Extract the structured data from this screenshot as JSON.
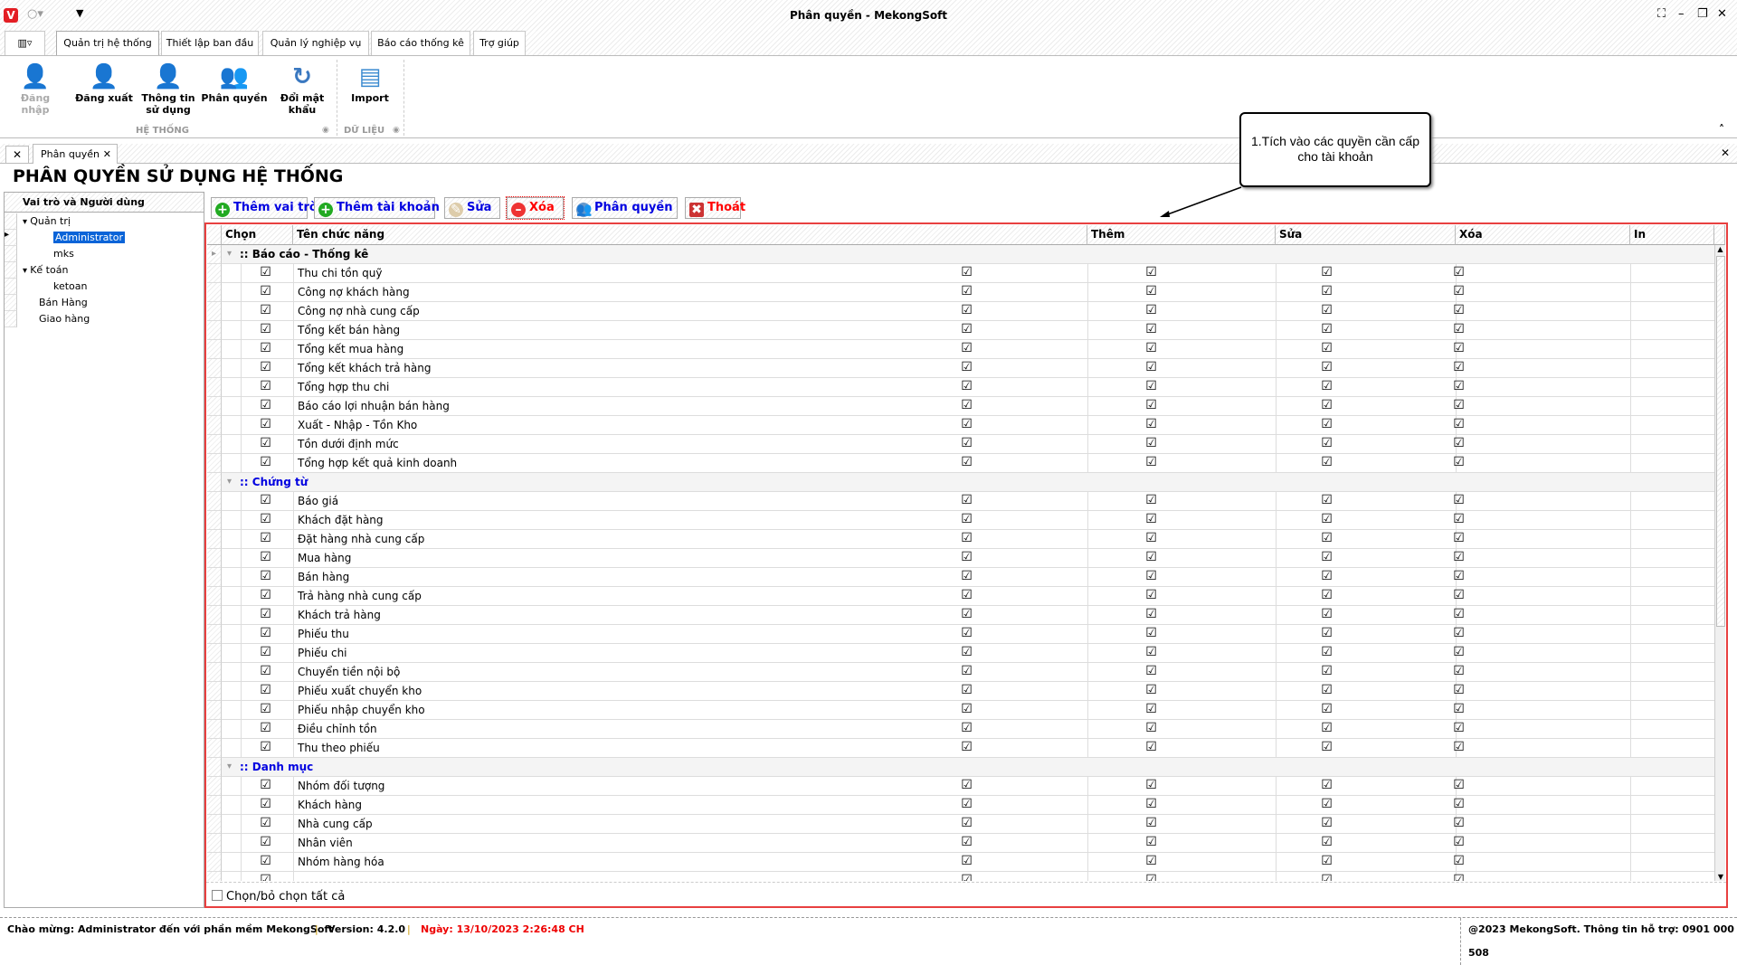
{
  "window": {
    "title": "Phân quyền - MekongSoft",
    "logo": "V"
  },
  "ribbon_tabs": [
    "Quản trị hệ thống",
    "Thiết lập ban đầu",
    "Quản lý nghiệp vụ",
    "Báo cáo thống kê",
    "Trợ giúp"
  ],
  "ribbon": {
    "buttons": [
      {
        "label": "Đăng nhập",
        "icon": "login-user-icon",
        "disabled": true
      },
      {
        "label": "Đăng xuất",
        "icon": "logout-user-icon"
      },
      {
        "label": "Thông tin sử dụng",
        "icon": "user-info-icon"
      },
      {
        "label": "Phân quyền",
        "icon": "users-gear-icon"
      },
      {
        "label": "Đổi mật khẩu",
        "icon": "refresh-icon"
      },
      {
        "label": "Import",
        "icon": "database-icon"
      }
    ],
    "groups": [
      "HỆ THỐNG",
      "DỮ LIỆU"
    ]
  },
  "doc_tab": "Phân quyền",
  "page_title": "PHÂN QUYỀN SỬ DỤNG HỆ THỐNG",
  "left_panel": {
    "header": "Vai trò và Người dùng",
    "nodes": [
      {
        "label": "Quản trị",
        "level": 0,
        "expanded": true
      },
      {
        "label": "Administrator",
        "level": 1,
        "selected": true
      },
      {
        "label": "mks",
        "level": 1
      },
      {
        "label": "Kế toán",
        "level": 0,
        "expanded": true
      },
      {
        "label": "ketoan",
        "level": 1
      },
      {
        "label": "Bán Hàng",
        "level": 0
      },
      {
        "label": "Giao hàng",
        "level": 0
      }
    ]
  },
  "toolbar": [
    {
      "label": "Thêm vai trò",
      "icon": "plus-circle-icon",
      "color": "#0000e0"
    },
    {
      "label": "Thêm tài khoản",
      "icon": "plus-circle-icon",
      "color": "#0000e0"
    },
    {
      "label": "Sửa",
      "icon": "pencil-icon",
      "color": "#0000e0"
    },
    {
      "label": "Xóa",
      "icon": "minus-circle-icon",
      "color": "#ff0000"
    },
    {
      "label": "Phân quyền",
      "icon": "users-icon",
      "color": "#0000e0"
    },
    {
      "label": "Thoát",
      "icon": "close-box-icon",
      "color": "#ff0000"
    }
  ],
  "grid": {
    "columns": [
      "Chọn",
      "Tên chức năng",
      "Thêm",
      "Sửa",
      "Xóa",
      "In"
    ],
    "groups": [
      {
        "title": ":: Báo cáo - Thống kê",
        "color": "#000000",
        "items": [
          "Thu chi tồn quỹ",
          "Công nợ khách hàng",
          "Công nợ nhà cung cấp",
          "Tổng kết bán hàng",
          "Tổng kết mua hàng",
          "Tổng kết khách trả hàng",
          "Tổng hợp thu chi",
          "Báo cáo lợi nhuận bán hàng",
          "Xuất - Nhập - Tồn Kho",
          "Tồn dưới định mức",
          "Tổng hợp kết quả kinh doanh"
        ]
      },
      {
        "title": ":: Chứng từ",
        "color": "#0000e0",
        "items": [
          "Báo giá",
          "Khách đặt hàng",
          "Đặt hàng nhà cung cấp",
          "Mua hàng",
          "Bán hàng",
          "Trả hàng nhà cung cấp",
          "Khách trả hàng",
          "Phiếu thu",
          "Phiếu chi",
          "Chuyển tiền nội bộ",
          "Phiếu xuất chuyển kho",
          "Phiếu nhập chuyển kho",
          "Điều chỉnh tồn",
          "Thu theo phiếu"
        ]
      },
      {
        "title": ":: Danh mục",
        "color": "#0000e0",
        "items": [
          "Nhóm đối tượng",
          "Khách hàng",
          "Nhà cung cấp",
          "Nhân viên",
          "Nhóm hàng hóa",
          ""
        ]
      }
    ],
    "all_checked": true
  },
  "select_all_label": "Chọn/bỏ chọn tất cả",
  "callout": "1.Tích vào các quyền cần cấp cho tài khoản",
  "status": {
    "welcome": "Chào mừng: Administrator đến với phần mềm MekongSoft",
    "version": "Version: 4.2.0",
    "date": "Ngày: 13/10/2023 2:26:48 CH",
    "copyright": "@2023 MekongSoft. Thông tin hỗ trợ: 0901 000 508"
  }
}
